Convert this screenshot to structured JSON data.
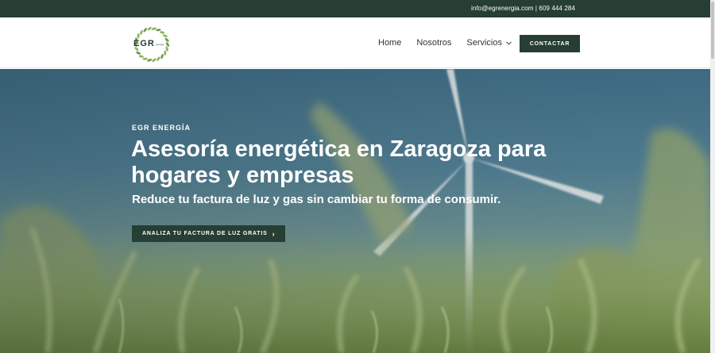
{
  "topbar": {
    "email": "info@egrenergia.com",
    "separator": "|",
    "phone": "609 444 284"
  },
  "header": {
    "logo_text": "EGR",
    "logo_subtext": "energía",
    "nav": [
      {
        "label": "Home"
      },
      {
        "label": "Nosotros"
      },
      {
        "label": "Servicios",
        "has_dropdown": true
      }
    ],
    "cta_label": "CONTACTAR"
  },
  "hero": {
    "eyebrow": "EGR ENERGÍA",
    "title": "Asesoría energética en Zaragoza para hogares y empresas",
    "subtitle": "Reduce tu factura de luz y gas sin cambiar tu forma de consumir.",
    "button_label": "ANALIZA TU FACTURA DE LUZ GRATIS",
    "button_icon": "chevron-right-icon"
  },
  "colors": {
    "brand_dark_green": "#263e33",
    "logo_leaf_green": "#7fae4f"
  }
}
